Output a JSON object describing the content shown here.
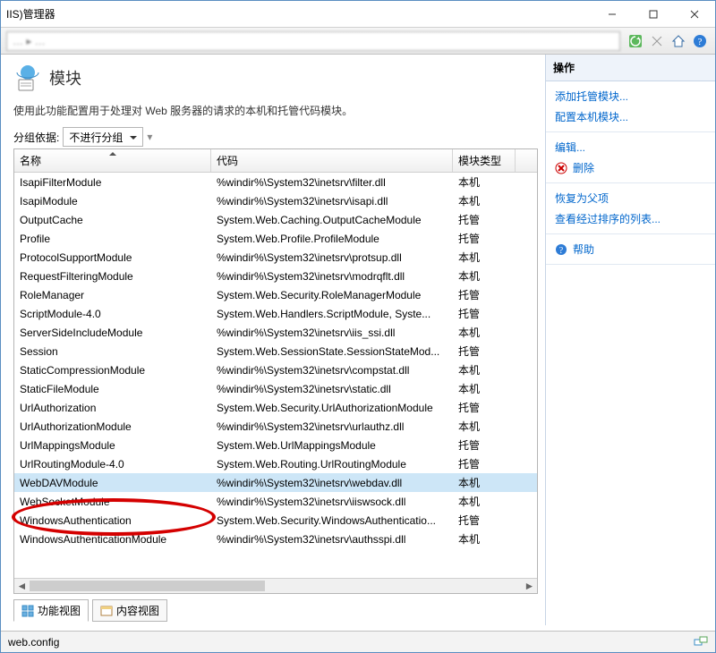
{
  "window": {
    "title_fragment": "IIS)管理器",
    "breadcrumb_blurred": "… ▸ …"
  },
  "page": {
    "title": "模块",
    "description": "使用此功能配置用于处理对 Web 服务器的请求的本机和托管代码模块。",
    "group_by_label": "分组依据:",
    "group_by_value": "不进行分组"
  },
  "grid": {
    "columns": {
      "name": "名称",
      "code": "代码",
      "type": "模块类型"
    },
    "rows": [
      {
        "name": "IsapiFilterModule",
        "code": "%windir%\\System32\\inetsrv\\filter.dll",
        "type": "本机"
      },
      {
        "name": "IsapiModule",
        "code": "%windir%\\System32\\inetsrv\\isapi.dll",
        "type": "本机"
      },
      {
        "name": "OutputCache",
        "code": "System.Web.Caching.OutputCacheModule",
        "type": "托管"
      },
      {
        "name": "Profile",
        "code": "System.Web.Profile.ProfileModule",
        "type": "托管"
      },
      {
        "name": "ProtocolSupportModule",
        "code": "%windir%\\System32\\inetsrv\\protsup.dll",
        "type": "本机"
      },
      {
        "name": "RequestFilteringModule",
        "code": "%windir%\\System32\\inetsrv\\modrqflt.dll",
        "type": "本机"
      },
      {
        "name": "RoleManager",
        "code": "System.Web.Security.RoleManagerModule",
        "type": "托管"
      },
      {
        "name": "ScriptModule-4.0",
        "code": "System.Web.Handlers.ScriptModule, Syste...",
        "type": "托管"
      },
      {
        "name": "ServerSideIncludeModule",
        "code": "%windir%\\System32\\inetsrv\\iis_ssi.dll",
        "type": "本机"
      },
      {
        "name": "Session",
        "code": "System.Web.SessionState.SessionStateMod...",
        "type": "托管"
      },
      {
        "name": "StaticCompressionModule",
        "code": "%windir%\\System32\\inetsrv\\compstat.dll",
        "type": "本机"
      },
      {
        "name": "StaticFileModule",
        "code": "%windir%\\System32\\inetsrv\\static.dll",
        "type": "本机"
      },
      {
        "name": "UrlAuthorization",
        "code": "System.Web.Security.UrlAuthorizationModule",
        "type": "托管"
      },
      {
        "name": "UrlAuthorizationModule",
        "code": "%windir%\\System32\\inetsrv\\urlauthz.dll",
        "type": "本机"
      },
      {
        "name": "UrlMappingsModule",
        "code": "System.Web.UrlMappingsModule",
        "type": "托管"
      },
      {
        "name": "UrlRoutingModule-4.0",
        "code": "System.Web.Routing.UrlRoutingModule",
        "type": "托管"
      },
      {
        "name": "WebDAVModule",
        "code": "%windir%\\System32\\inetsrv\\webdav.dll",
        "type": "本机",
        "selected": true
      },
      {
        "name": "WebSocketModule",
        "code": "%windir%\\System32\\inetsrv\\iiswsock.dll",
        "type": "本机"
      },
      {
        "name": "WindowsAuthentication",
        "code": "System.Web.Security.WindowsAuthenticatio...",
        "type": "托管"
      },
      {
        "name": "WindowsAuthenticationModule",
        "code": "%windir%\\System32\\inetsrv\\authsspi.dll",
        "type": "本机"
      }
    ]
  },
  "tabs": {
    "features": "功能视图",
    "content": "内容视图"
  },
  "actions": {
    "header": "操作",
    "add_managed": "添加托管模块...",
    "configure_native": "配置本机模块...",
    "edit": "编辑...",
    "delete": "删除",
    "revert": "恢复为父项",
    "view_ordered": "查看经过排序的列表...",
    "help": "帮助"
  },
  "status": {
    "config": "web.config"
  }
}
